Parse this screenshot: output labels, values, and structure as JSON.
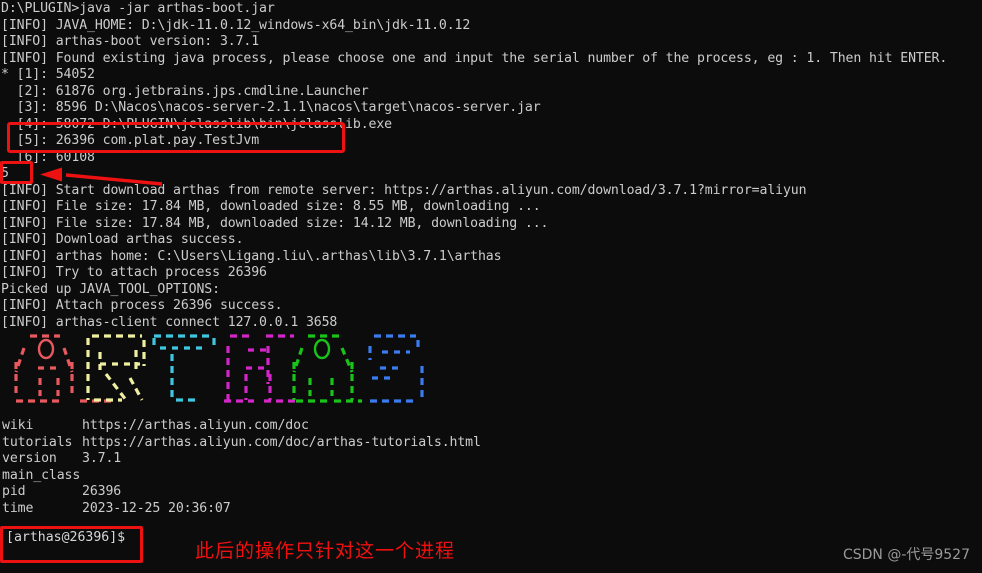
{
  "terminal": {
    "prompt_header": "D:\\PLUGIN>java -jar arthas-boot.jar",
    "lines": [
      "D:\\PLUGIN>java -jar arthas-boot.jar",
      "[INFO] JAVA_HOME: D:\\jdk-11.0.12_windows-x64_bin\\jdk-11.0.12",
      "[INFO] arthas-boot version: 3.7.1",
      "[INFO] Found existing java process, please choose one and input the serial number of the process, eg : 1. Then hit ENTER.",
      "* [1]: 54052",
      "  [2]: 61876 org.jetbrains.jps.cmdline.Launcher",
      "  [3]: 8596 D:\\Nacos\\nacos-server-2.1.1\\nacos\\target\\nacos-server.jar",
      "  [4]: 58072 D:\\PLUGIN\\jclasslib\\bin\\jclasslib.exe",
      "  [5]: 26396 com.plat.pay.TestJvm",
      "  [6]: 60108",
      "5",
      "[INFO] Start download arthas from remote server: https://arthas.aliyun.com/download/3.7.1?mirror=aliyun",
      "[INFO] File size: 17.84 MB, downloaded size: 8.55 MB, downloading ...",
      "[INFO] File size: 17.84 MB, downloaded size: 14.12 MB, downloading ...",
      "[INFO] Download arthas success.",
      "[INFO] arthas home: C:\\Users\\Ligang.liu\\.arthas\\lib\\3.7.1\\arthas",
      "[INFO] Try to attach process 26396",
      "Picked up JAVA_TOOL_OPTIONS:",
      "[INFO] Attach process 26396 success.",
      "[INFO] arthas-client connect 127.0.0.1 3658"
    ]
  },
  "banner": {
    "letters": [
      {
        "name": "A",
        "color": "#e8595f"
      },
      {
        "name": "R",
        "color": "#efefa0"
      },
      {
        "name": "T",
        "color": "#3ec7e0"
      },
      {
        "name": "H",
        "color": "#d426c8"
      },
      {
        "name": "A",
        "color": "#19c419"
      },
      {
        "name": "S",
        "color": "#3a7bf0"
      }
    ],
    "rows": [
      "  ,---.  ,---.  ,---.  ,---.  ,---.  ,---.  ",
      " /  O  \\ |   .'  ;   ; |   ; |  /  O  \\ ;   ; ",
      "|  .-.  ||  _ <   |   | |  --  ||  .-.  ||  .-' ",
      "|  | |  ||  |\\  \\ |   | |  |   ||  | |  ||  `-. ",
      "`--' `--'`--' '--'`---' `--'   ``--' `--' `---' "
    ]
  },
  "info": {
    "rows": [
      {
        "key": "wiki",
        "value": "https://arthas.aliyun.com/doc"
      },
      {
        "key": "tutorials",
        "value": "https://arthas.aliyun.com/doc/arthas-tutorials.html"
      },
      {
        "key": "version",
        "value": "3.7.1"
      },
      {
        "key": "main_class",
        "value": ""
      },
      {
        "key": "pid",
        "value": "26396"
      },
      {
        "key": "time",
        "value": "2023-12-25 20:36:07"
      }
    ]
  },
  "prompt": {
    "text": "[arthas@26396]$"
  },
  "annotations": {
    "color": "#ee1111",
    "note_text": "此后的操作只针对这一个进程",
    "highlight_process": "  [5]: 26396 com.plat.pay.TestJvm",
    "highlight_input": "5"
  },
  "watermark": {
    "text": "CSDN @-代号9527"
  }
}
